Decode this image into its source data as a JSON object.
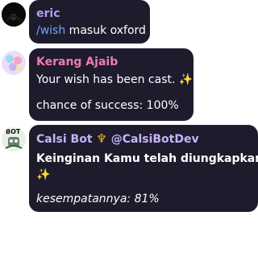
{
  "messages": [
    {
      "author": "eric",
      "author_color": "#b89cf0",
      "command": "/wish",
      "body": " masuk oxford",
      "avatar_icon": "avatar-dark-icon"
    },
    {
      "author": "Kerang Ajaib",
      "author_color": "#f07ab4",
      "line1": "Your wish has been cast.",
      "sparkle": "✨",
      "line2": "chance of success: 100%",
      "avatar_icon": "avatar-pastel-icon"
    },
    {
      "author": "Calsi Bot",
      "author_color": "#c7b3ff",
      "bot_badge": "♆",
      "handle": "@CalsiBotDev",
      "line1": "Keinginan Kamu telah diungkapkan.",
      "sparkle": "✨",
      "line2": "kesempatannya: 81%",
      "avatar_label": "BOT",
      "avatar_icon": "avatar-bot-icon"
    }
  ]
}
